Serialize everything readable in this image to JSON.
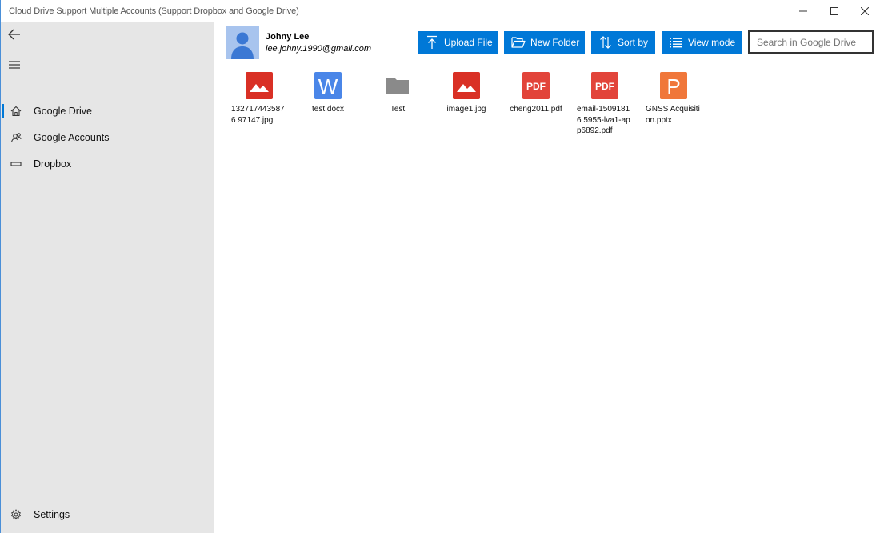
{
  "window": {
    "title": "Cloud Drive Support Multiple Accounts (Support Dropbox and Google Drive)"
  },
  "sidebar": {
    "items": [
      {
        "label": "Google Drive",
        "icon": "home-icon",
        "active": true
      },
      {
        "label": "Google Accounts",
        "icon": "accounts-icon",
        "active": false
      },
      {
        "label": "Dropbox",
        "icon": "dropbox-icon",
        "active": false
      }
    ],
    "settings_label": "Settings"
  },
  "user": {
    "name": "Johny Lee",
    "email": "lee.johny.1990@gmail.com"
  },
  "toolbar": {
    "upload_label": "Upload File",
    "new_folder_label": "New Folder",
    "sort_label": "Sort by",
    "view_mode_label": "View mode",
    "search_placeholder": "Search in Google Drive"
  },
  "files": [
    {
      "name": "1327174435876 97147.jpg",
      "type": "image"
    },
    {
      "name": "test.docx",
      "type": "word"
    },
    {
      "name": "Test",
      "type": "folder"
    },
    {
      "name": "image1.jpg",
      "type": "image"
    },
    {
      "name": "cheng2011.pdf",
      "type": "pdf"
    },
    {
      "name": "email-15091816 5955-lva1-app6892.pdf",
      "type": "pdf"
    },
    {
      "name": "GNSS Acquisition.pptx",
      "type": "powerpoint"
    }
  ],
  "colors": {
    "accent": "#0078d7",
    "sidebar_bg": "#e6e6e6",
    "image_icon": "#d93025",
    "pdf_icon": "#e2443a",
    "word_icon": "#4a86e8",
    "folder_icon": "#8a8a8a",
    "ppt_icon": "#f0773a"
  }
}
